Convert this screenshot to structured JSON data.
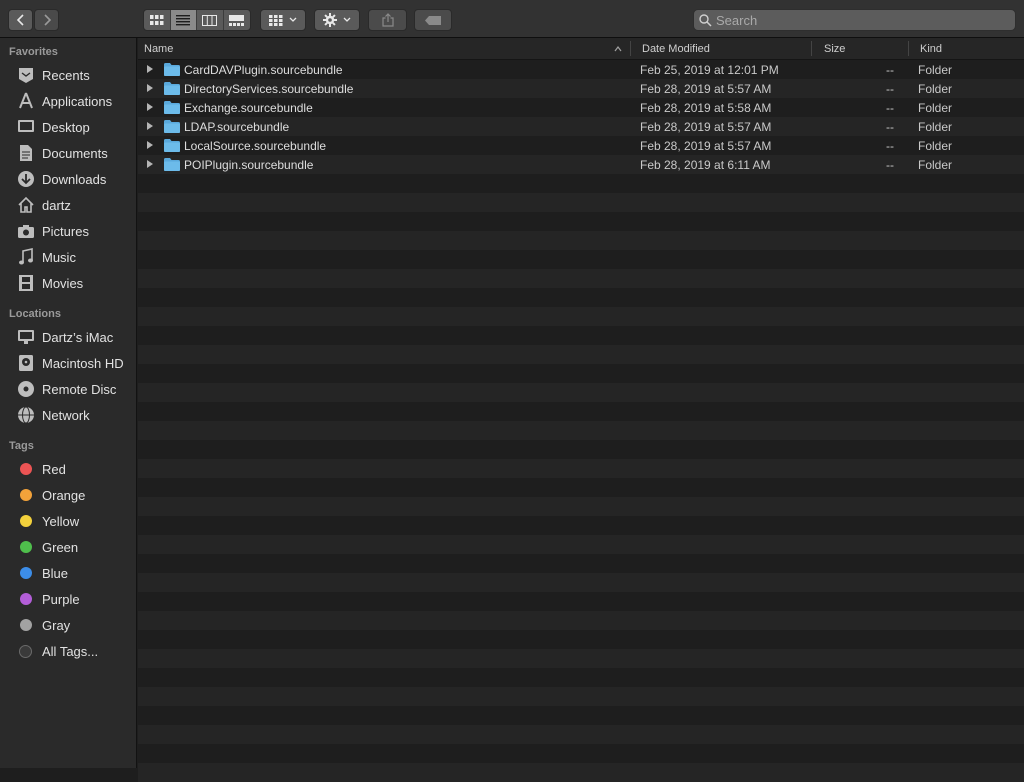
{
  "toolbar": {
    "back_icon": "chevron-left-icon",
    "forward_icon": "chevron-right-icon",
    "view_modes": [
      "icon-view",
      "list-view",
      "column-view",
      "gallery-view"
    ],
    "active_view": "list-view",
    "group_icon": "grid-group-icon",
    "action_icon": "gear-icon",
    "share_icon": "share-icon",
    "tag_icon": "tag-icon",
    "search_placeholder": "Search"
  },
  "sidebar": {
    "favorites_title": "Favorites",
    "favorites": [
      {
        "label": "Recents",
        "icon": "clock-icon"
      },
      {
        "label": "Applications",
        "icon": "applications-icon"
      },
      {
        "label": "Desktop",
        "icon": "desktop-icon"
      },
      {
        "label": "Documents",
        "icon": "document-icon"
      },
      {
        "label": "Downloads",
        "icon": "download-icon"
      },
      {
        "label": "dartz",
        "icon": "home-icon"
      },
      {
        "label": "Pictures",
        "icon": "camera-icon"
      },
      {
        "label": "Music",
        "icon": "music-note-icon"
      },
      {
        "label": "Movies",
        "icon": "film-icon"
      }
    ],
    "locations_title": "Locations",
    "locations": [
      {
        "label": "Dartz’s iMac",
        "icon": "imac-icon"
      },
      {
        "label": "Macintosh HD",
        "icon": "hard-drive-icon"
      },
      {
        "label": "Remote Disc",
        "icon": "disc-icon"
      },
      {
        "label": "Network",
        "icon": "globe-icon"
      }
    ],
    "tags_title": "Tags",
    "tags": [
      {
        "label": "Red",
        "color": "#ec5454"
      },
      {
        "label": "Orange",
        "color": "#f2a23a"
      },
      {
        "label": "Yellow",
        "color": "#f3d13c"
      },
      {
        "label": "Green",
        "color": "#4fbf4c"
      },
      {
        "label": "Blue",
        "color": "#3c8de8"
      },
      {
        "label": "Purple",
        "color": "#b35ed8"
      },
      {
        "label": "Gray",
        "color": "#a2a2a2"
      },
      {
        "label": "All Tags...",
        "color": "#3a3a3a"
      }
    ]
  },
  "columns": {
    "name": "Name",
    "date_modified": "Date Modified",
    "size": "Size",
    "kind": "Kind",
    "sort_indicator": "chevron-up-icon"
  },
  "files": [
    {
      "name": "CardDAVPlugin.sourcebundle",
      "date": "Feb 25, 2019 at 12:01 PM",
      "size": "--",
      "kind": "Folder"
    },
    {
      "name": "DirectoryServices.sourcebundle",
      "date": "Feb 28, 2019 at 5:57 AM",
      "size": "--",
      "kind": "Folder"
    },
    {
      "name": "Exchange.sourcebundle",
      "date": "Feb 28, 2019 at 5:58 AM",
      "size": "--",
      "kind": "Folder"
    },
    {
      "name": "LDAP.sourcebundle",
      "date": "Feb 28, 2019 at 5:57 AM",
      "size": "--",
      "kind": "Folder"
    },
    {
      "name": "LocalSource.sourcebundle",
      "date": "Feb 28, 2019 at 5:57 AM",
      "size": "--",
      "kind": "Folder"
    },
    {
      "name": "POIPlugin.sourcebundle",
      "date": "Feb 28, 2019 at 6:11 AM",
      "size": "--",
      "kind": "Folder"
    }
  ],
  "colors": {
    "folder": "#62b4e6",
    "background": "#1e1e1e",
    "sidebar": "#2a2a2a"
  }
}
